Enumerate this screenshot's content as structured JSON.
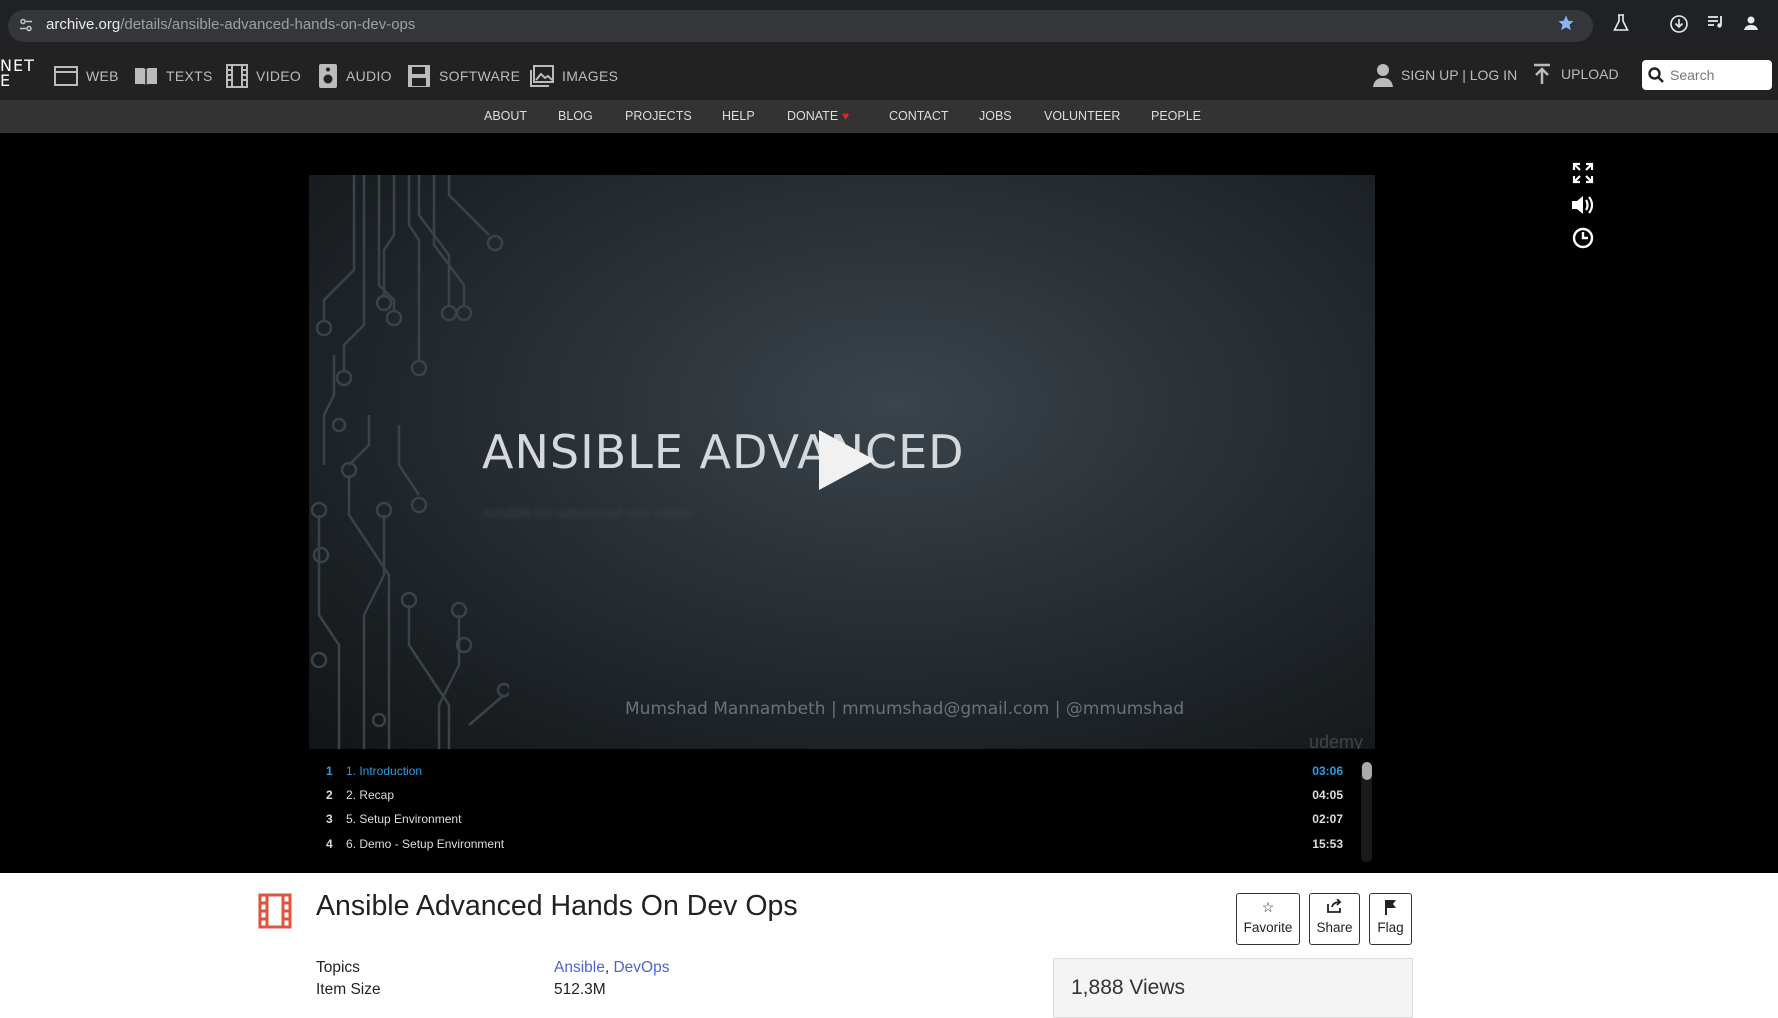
{
  "browser": {
    "url_host": "archive.org",
    "url_path": "/details/ansible-advanced-hands-on-dev-ops",
    "icons": [
      "site-info-icon",
      "bookmark-star-icon",
      "labs-flask-icon",
      "download-icon",
      "media-control-icon",
      "profile-icon"
    ]
  },
  "ia_nav": {
    "logo_lines": [
      "NET",
      "E"
    ],
    "media": [
      "WEB",
      "TEXTS",
      "VIDEO",
      "AUDIO",
      "SOFTWARE",
      "IMAGES"
    ],
    "auth": "SIGN UP | LOG IN",
    "upload": "UPLOAD",
    "search_placeholder": "Search"
  },
  "sub_nav": [
    "ABOUT",
    "BLOG",
    "PROJECTS",
    "HELP",
    "DONATE",
    "CONTACT",
    "JOBS",
    "VOLUNTEER",
    "PEOPLE"
  ],
  "player": {
    "slide_title": "ANSIBLE ADVANCED",
    "slide_subtitle": "Ansible for advanced use cases",
    "slide_credit": "Mumshad Mannambeth | mmumshad@gmail.com | @mmumshad",
    "slide_brand": "udemy",
    "controls": [
      "fullscreen-icon",
      "volume-icon",
      "clock-icon"
    ]
  },
  "playlist": [
    {
      "num": "1",
      "title": "1. Introduction",
      "duration": "03:06",
      "active": true
    },
    {
      "num": "2",
      "title": "2. Recap",
      "duration": "04:05",
      "active": false
    },
    {
      "num": "3",
      "title": "5. Setup Environment",
      "duration": "02:07",
      "active": false
    },
    {
      "num": "4",
      "title": "6. Demo - Setup Environment",
      "duration": "15:53",
      "active": false
    }
  ],
  "item": {
    "title": "Ansible Advanced Hands On Dev Ops",
    "actions": {
      "favorite": "Favorite",
      "share": "Share",
      "flag": "Flag"
    },
    "topics_label": "Topics",
    "topics": [
      "Ansible",
      "DevOps"
    ],
    "size_label": "Item Size",
    "size_value": "512.3M",
    "views": "1,888 Views"
  },
  "colors": {
    "accent_link": "#4b64d2",
    "playlist_active": "#28a0e6",
    "donate_heart": "#e6251a",
    "film_icon": "#e0533e"
  }
}
